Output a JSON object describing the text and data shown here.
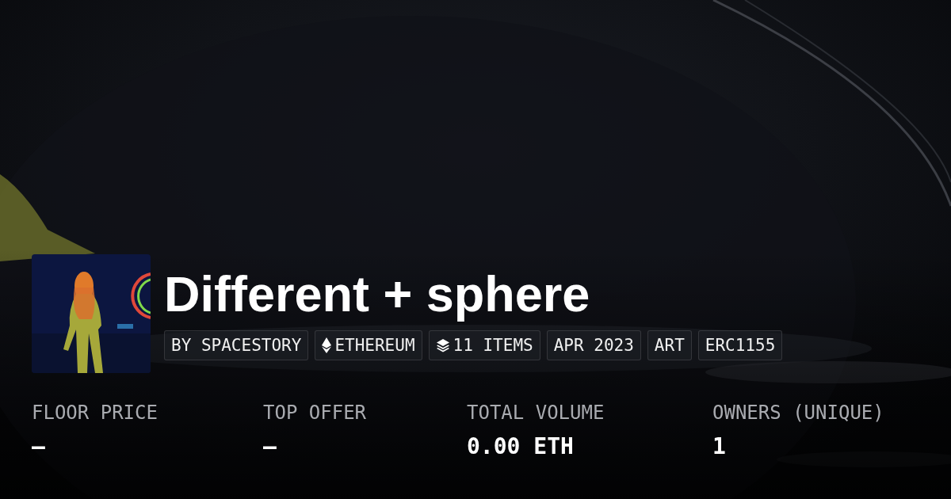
{
  "collection": {
    "title": "Different + sphere",
    "tags": [
      {
        "kind": "text",
        "label": "BY SPACESTORY"
      },
      {
        "kind": "chain",
        "label": "ETHEREUM"
      },
      {
        "kind": "items",
        "label": "11 ITEMS"
      },
      {
        "kind": "text",
        "label": "APR 2023"
      },
      {
        "kind": "text",
        "label": "ART"
      },
      {
        "kind": "text",
        "label": "ERC1155"
      }
    ]
  },
  "stats": [
    {
      "label": "FLOOR PRICE",
      "value": "–"
    },
    {
      "label": "TOP OFFER",
      "value": "–"
    },
    {
      "label": "TOTAL VOLUME",
      "value": "0.00 ETH"
    },
    {
      "label": "OWNERS (UNIQUE)",
      "value": "1"
    }
  ]
}
